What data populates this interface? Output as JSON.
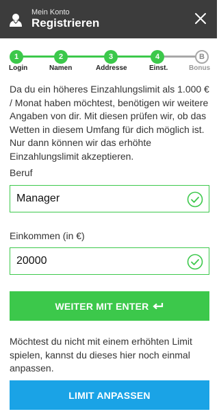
{
  "header": {
    "subtitle": "Mein Konto",
    "title": "Registrieren"
  },
  "stepper": {
    "steps": [
      {
        "number": "1",
        "label": "Login"
      },
      {
        "number": "2",
        "label": "Namen"
      },
      {
        "number": "3",
        "label": "Addresse"
      },
      {
        "number": "4",
        "label": "Einst."
      },
      {
        "number": "B",
        "label": "Bonus"
      }
    ]
  },
  "intro_text": "Da du ein höheres Einzahlungslimit als 1.000 € / Monat haben möchtest, benötigen wir weitere Angaben von dir. Mit diesen prüfen wir, ob das Wetten in diesem Umfang für dich möglich ist. Nur dann können wir das erhöhte Einzahlungslimit akzeptieren.",
  "form": {
    "beruf": {
      "label": "Beruf",
      "value": "Manager"
    },
    "einkommen": {
      "label": "Einkommen (in €)",
      "value": "20000"
    }
  },
  "buttons": {
    "continue_label": "WEITER MIT ENTER",
    "adjust_limit_label": "LIMIT ANPASSEN"
  },
  "note_text": "Möchtest du nicht mit einem erhöhten Limit spielen, kannst du dieses hier noch einmal anpassen.",
  "colors": {
    "header_bg": "#3c3c3c",
    "accent_green": "#3cc84b",
    "accent_blue": "#1aa3e6",
    "inactive_grey": "#a8a8a8"
  },
  "icons": {
    "header": "user-icon",
    "close": "close-icon",
    "field_valid": "check-circle-icon",
    "continue": "enter-icon"
  }
}
